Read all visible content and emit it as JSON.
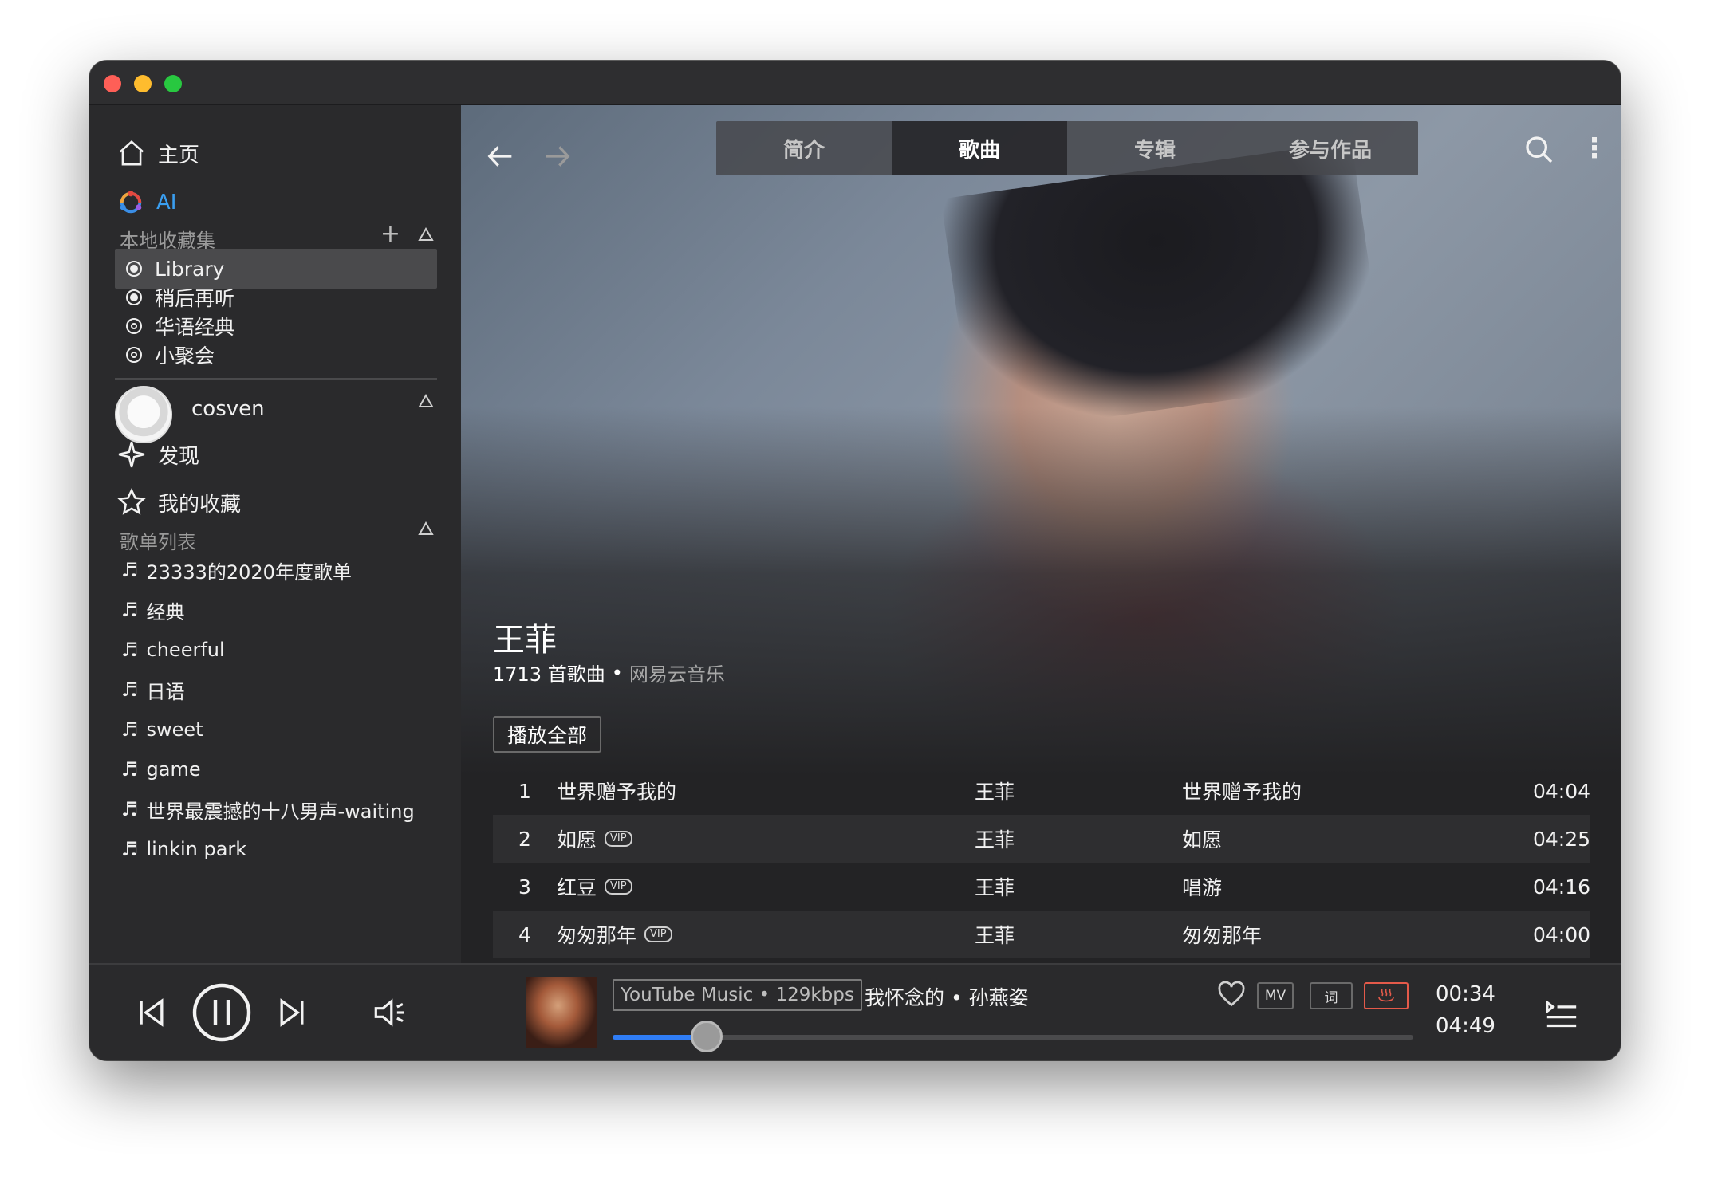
{
  "sidebar": {
    "home": "主页",
    "ai": "AI",
    "local_collections_label": "本地收藏集",
    "collections": [
      "Library",
      "稍后再听",
      "华语经典",
      "小聚会"
    ],
    "username": "cosven",
    "discover": "发现",
    "favorites": "我的收藏",
    "playlists_label": "歌单列表",
    "playlists": [
      "23333的2020年度歌单",
      "经典",
      "cheerful",
      "日语",
      "sweet",
      "game",
      "世界最震撼的十八男声-waiting",
      "linkin park"
    ]
  },
  "tabs": [
    "简介",
    "歌曲",
    "专辑",
    "参与作品"
  ],
  "active_tab": "歌曲",
  "artist": {
    "name": "王菲",
    "count_text": "1713 首歌曲",
    "separator": "•",
    "source": "网易云音乐",
    "play_all": "播放全部"
  },
  "songs": [
    {
      "index": "1",
      "title": "世界赠予我的",
      "vip": "",
      "artist": "王菲",
      "album": "世界赠予我的",
      "duration": "04:04"
    },
    {
      "index": "2",
      "title": "如愿",
      "vip": "VIP",
      "artist": "王菲",
      "album": "如愿",
      "duration": "04:25"
    },
    {
      "index": "3",
      "title": "红豆",
      "vip": "VIP",
      "artist": "王菲",
      "album": "唱游",
      "duration": "04:16"
    },
    {
      "index": "4",
      "title": "匆匆那年",
      "vip": "VIP",
      "artist": "王菲",
      "album": "匆匆那年",
      "duration": "04:00"
    }
  ],
  "player": {
    "source_tag": "YouTube Music • 129kbps",
    "now_playing": "我怀念的 • 孙燕姿",
    "mv_label": "MV",
    "lyric_label": "词",
    "current_time": "00:34",
    "total_time": "04:49",
    "progress_fraction": 0.118
  },
  "colors": {
    "accent": "#2f7df6",
    "ai_gradient_a": "#e4493f",
    "ai_gradient_b": "#3a8ee6",
    "hot_red": "#e45a4a"
  }
}
